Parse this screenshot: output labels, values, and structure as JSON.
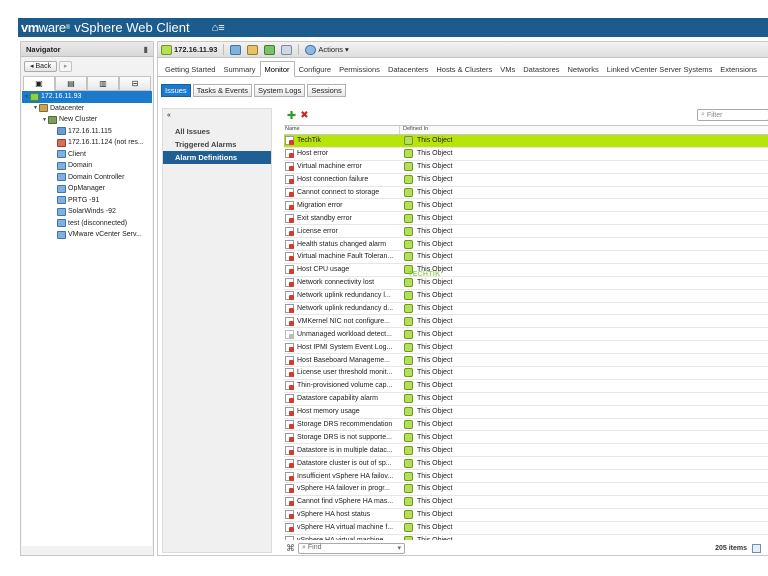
{
  "header": {
    "logo_vm": "vm",
    "logo_ware": "ware",
    "logo_reg": "®",
    "product": "vSphere Web Client",
    "home_icon": "home-icon",
    "menu_icon": "menu-icon"
  },
  "navigator": {
    "title": "Navigator",
    "back_label": "Back",
    "tree": [
      {
        "label": "172.16.11.93",
        "level": 0,
        "icon": "vc",
        "selected": true
      },
      {
        "label": "Datacenter",
        "level": 1,
        "icon": "dc"
      },
      {
        "label": "New Cluster",
        "level": 2,
        "icon": "cluster"
      },
      {
        "label": "172.16.11.115",
        "level": 3,
        "icon": "host"
      },
      {
        "label": "172.16.11.124 (not res...",
        "level": 3,
        "icon": "host-red"
      },
      {
        "label": "Client",
        "level": 3,
        "icon": "vm"
      },
      {
        "label": "Domain",
        "level": 3,
        "icon": "vm"
      },
      {
        "label": "Domain Controller",
        "level": 3,
        "icon": "vm"
      },
      {
        "label": "OpManager",
        "level": 3,
        "icon": "vm"
      },
      {
        "label": "PRTG -91",
        "level": 3,
        "icon": "vm"
      },
      {
        "label": "SolarWinds -92",
        "level": 3,
        "icon": "vm"
      },
      {
        "label": "test (disconnected)",
        "level": 3,
        "icon": "vm"
      },
      {
        "label": "VMware vCenter Serv...",
        "level": 3,
        "icon": "vm"
      }
    ]
  },
  "object_toolbar": {
    "object_name": "172.16.11.93",
    "actions_label": "Actions"
  },
  "tabs": [
    {
      "label": "Getting Started"
    },
    {
      "label": "Summary"
    },
    {
      "label": "Monitor",
      "active": true
    },
    {
      "label": "Configure"
    },
    {
      "label": "Permissions"
    },
    {
      "label": "Datacenters"
    },
    {
      "label": "Hosts & Clusters"
    },
    {
      "label": "VMs"
    },
    {
      "label": "Datastores"
    },
    {
      "label": "Networks"
    },
    {
      "label": "Linked vCenter Server Systems"
    },
    {
      "label": "Extensions"
    }
  ],
  "subtabs": [
    {
      "label": "Issues",
      "active": true
    },
    {
      "label": "Tasks & Events"
    },
    {
      "label": "System Logs"
    },
    {
      "label": "Sessions"
    }
  ],
  "left_menu": {
    "collapse": "«",
    "items": [
      {
        "label": "All Issues"
      },
      {
        "label": "Triggered Alarms"
      },
      {
        "label": "Alarm Definitions",
        "selected": true
      }
    ]
  },
  "content": {
    "filter_placeholder": "Filter",
    "col_name": "Name",
    "col_defined_in": "Defined In",
    "watermark": "TECHTIK",
    "find_placeholder": "Find",
    "items_count": "205 items",
    "rows": [
      {
        "name": "TechTik",
        "defined_in": "This Object",
        "selected": true
      },
      {
        "name": "Host error",
        "defined_in": "This Object"
      },
      {
        "name": "Virtual machine error",
        "defined_in": "This Object"
      },
      {
        "name": "Host connection failure",
        "defined_in": "This Object"
      },
      {
        "name": "Cannot connect to storage",
        "defined_in": "This Object"
      },
      {
        "name": "Migration error",
        "defined_in": "This Object"
      },
      {
        "name": "Exit standby error",
        "defined_in": "This Object"
      },
      {
        "name": "License error",
        "defined_in": "This Object"
      },
      {
        "name": "Health status changed alarm",
        "defined_in": "This Object"
      },
      {
        "name": "Virtual machine Fault Toleran...",
        "defined_in": "This Object"
      },
      {
        "name": "Host CPU usage",
        "defined_in": "This Object"
      },
      {
        "name": "Network connectivity lost",
        "defined_in": "This Object"
      },
      {
        "name": "Network uplink redundancy l...",
        "defined_in": "This Object"
      },
      {
        "name": "Network uplink redundancy d...",
        "defined_in": "This Object"
      },
      {
        "name": "VMKernel NIC not configure...",
        "defined_in": "This Object"
      },
      {
        "name": "Unmanaged workload detect...",
        "defined_in": "This Object",
        "disabled": true
      },
      {
        "name": "Host IPMI System Event Log...",
        "defined_in": "This Object"
      },
      {
        "name": "Host Baseboard Manageme...",
        "defined_in": "This Object"
      },
      {
        "name": "License user threshold monit...",
        "defined_in": "This Object"
      },
      {
        "name": "Thin-provisioned volume cap...",
        "defined_in": "This Object"
      },
      {
        "name": "Datastore capability alarm",
        "defined_in": "This Object"
      },
      {
        "name": "Host memory usage",
        "defined_in": "This Object"
      },
      {
        "name": "Storage DRS recommendation",
        "defined_in": "This Object"
      },
      {
        "name": "Storage DRS is not supporte...",
        "defined_in": "This Object"
      },
      {
        "name": "Datastore is in multiple datac...",
        "defined_in": "This Object"
      },
      {
        "name": "Datastore cluster is out of sp...",
        "defined_in": "This Object"
      },
      {
        "name": "Insufficient vSphere HA failov...",
        "defined_in": "This Object"
      },
      {
        "name": "vSphere HA failover in progr...",
        "defined_in": "This Object"
      },
      {
        "name": "Cannot find vSphere HA mas...",
        "defined_in": "This Object"
      },
      {
        "name": "vSphere HA host status",
        "defined_in": "This Object"
      },
      {
        "name": "vSphere HA virtual machine f...",
        "defined_in": "This Object"
      },
      {
        "name": "vSphere HA virtual machine ...",
        "defined_in": "This Object"
      }
    ]
  }
}
